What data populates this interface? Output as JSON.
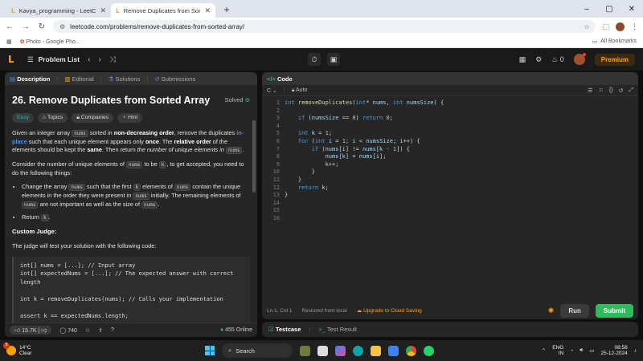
{
  "browser": {
    "tabs": [
      {
        "title": "Kavya_programming - LeetCode",
        "active": false
      },
      {
        "title": "Remove Duplicates from Sorted",
        "active": true
      }
    ],
    "url": "leetcode.com/problems/remove-duplicates-from-sorted-array/",
    "bookmark": "Photo - Google Pho...",
    "all_bookmarks": "All Bookmarks"
  },
  "header": {
    "problem_list": "Problem List",
    "streak": "0",
    "premium": "Premium"
  },
  "left_tabs": [
    "Description",
    "Editorial",
    "Solutions",
    "Submissions"
  ],
  "problem": {
    "title": "26. Remove Duplicates from Sorted Array",
    "status": "Solved",
    "chips": [
      "Easy",
      "Topics",
      "Companies",
      "Hint"
    ],
    "custom_judge": "Custom Judge:",
    "judge_intro": "The judge will test your solution with the following code:",
    "judge_code": "int[] nums = [...]; // Input array\nint[] expectedNums = [...]; // The expected answer with correct length\n\nint k = removeDuplicates(nums); // Calls your implementation\n\nassert k == expectedNums.length;"
  },
  "left_footer": {
    "likes": "15.7K",
    "comments": "740",
    "online": "455 Online"
  },
  "code_panel": {
    "title": "Code",
    "lang": "C",
    "mode": "Auto",
    "status_pos": "Ln 1, Col 1",
    "status_restored": "Restored from local",
    "status_upgrade": "Upgrade to Cloud Saving",
    "run": "Run",
    "submit": "Submit"
  },
  "bottom_tabs": [
    "Testcase",
    "Test Result"
  ],
  "taskbar": {
    "temp": "14°C",
    "weather": "Clear",
    "weather_badge": "9",
    "search": "Search",
    "lang": "ENG",
    "region": "IN",
    "time": "08:58",
    "date": "25-12-2024"
  },
  "colors": {
    "accent": "#ffa116",
    "easy": "#1cbaba",
    "submit": "#2cbb5d",
    "link": "#4a90e2"
  }
}
